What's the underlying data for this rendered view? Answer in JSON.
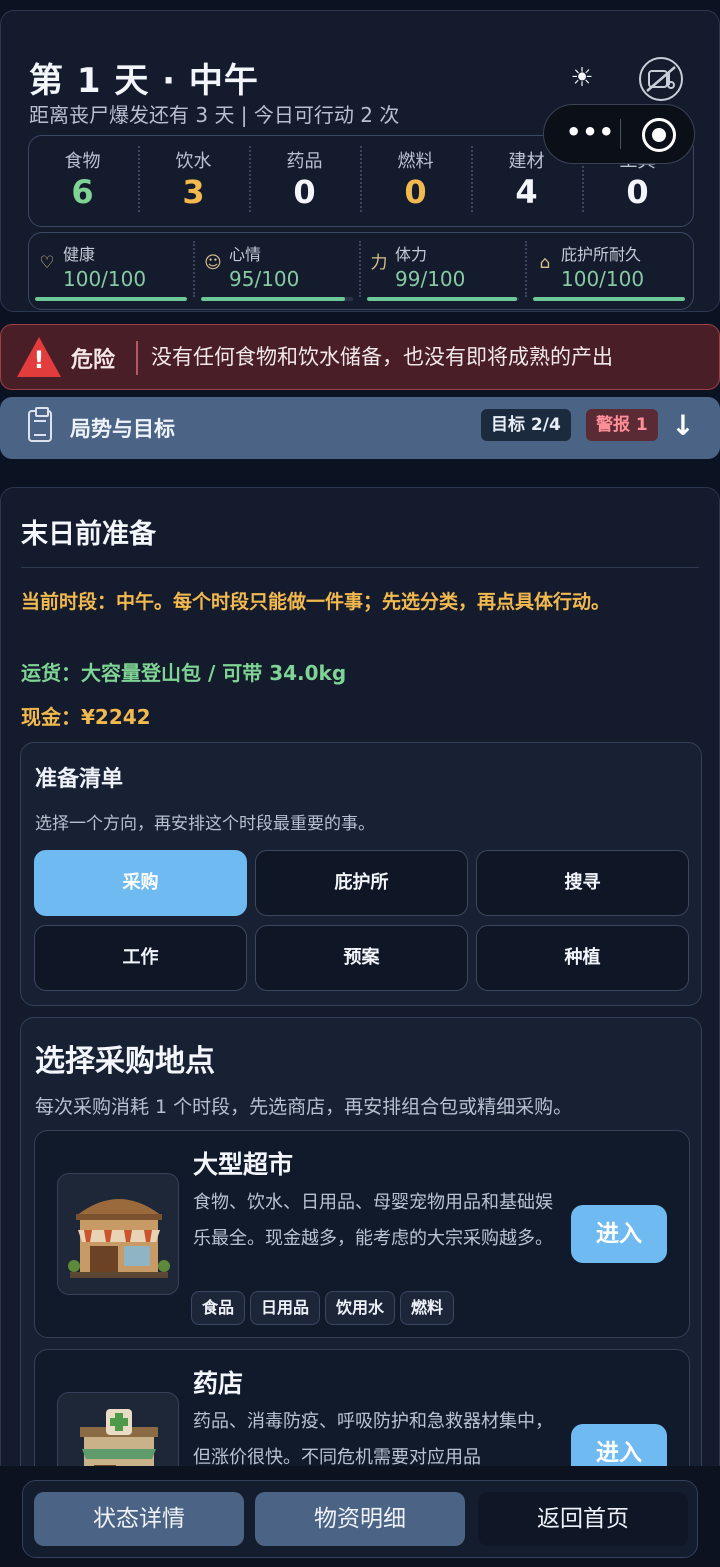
{
  "header": {
    "title": "第 1 天 · 中午",
    "subtitle": "距离丧尸爆发还有 3 天 | 今日可行动 2 次",
    "weather_icon": "sun-icon",
    "music_icon": "music-off-icon"
  },
  "resources": [
    {
      "label": "食物",
      "value": "6",
      "color": "#7fd394"
    },
    {
      "label": "饮水",
      "value": "3",
      "color": "#f2b94f"
    },
    {
      "label": "药品",
      "value": "0",
      "color": "#f2f5fa"
    },
    {
      "label": "燃料",
      "value": "0",
      "color": "#f2b94f"
    },
    {
      "label": "建材",
      "value": "4",
      "color": "#f2f5fa"
    },
    {
      "label": "工具",
      "value": "0",
      "color": "#f2f5fa"
    }
  ],
  "stats": [
    {
      "label": "健康",
      "value": "100/100",
      "icon": "heart-icon",
      "level": 1.0
    },
    {
      "label": "心情",
      "value": "95/100",
      "icon": "smile-icon",
      "level": 0.95
    },
    {
      "label": "体力",
      "value": "99/100",
      "icon": "strength-icon",
      "level": 0.99
    },
    {
      "label": "庇护所耐久",
      "value": "100/100",
      "icon": "house-icon",
      "level": 1.0
    }
  ],
  "danger": {
    "tag": "危险",
    "message": "没有任何食物和饮水储备，也没有即将成熟的产出"
  },
  "situation": {
    "title": "局势与目标",
    "goal_badge": "目标 2/4",
    "alarm_badge": "警报 1"
  },
  "main": {
    "title": "末日前准备",
    "info_period": "当前时段：中午。每个时段只能做一件事；先选分类，再点具体行动。",
    "info_carry": "运货：大容量登山包 / 可带 34.0kg",
    "info_cash": "现金：¥2242"
  },
  "prep": {
    "title": "准备清单",
    "desc": "选择一个方向，再安排这个时段最重要的事。",
    "categories": [
      "采购",
      "庇护所",
      "搜寻",
      "工作",
      "预案",
      "种植"
    ],
    "active": "采购"
  },
  "locations": {
    "title": "选择采购地点",
    "desc": "每次采购消耗 1 个时段，先选商店，再安排组合包或精细采购。",
    "shops": [
      {
        "name": "大型超市",
        "desc": "食物、饮水、日用品、母婴宠物用品和基础娱乐最全。现金越多，能考虑的大宗采购越多。",
        "tags": [
          "食品",
          "日用品",
          "饮用水",
          "燃料"
        ],
        "button": "进入"
      },
      {
        "name": "药店",
        "desc": "药品、消毒防疫、呼吸防护和急救器材集中，但涨价很快。不同危机需要对应用品",
        "tags": [],
        "button": "进入"
      }
    ]
  },
  "bottom_nav": [
    "状态详情",
    "物资明细",
    "返回首页"
  ]
}
